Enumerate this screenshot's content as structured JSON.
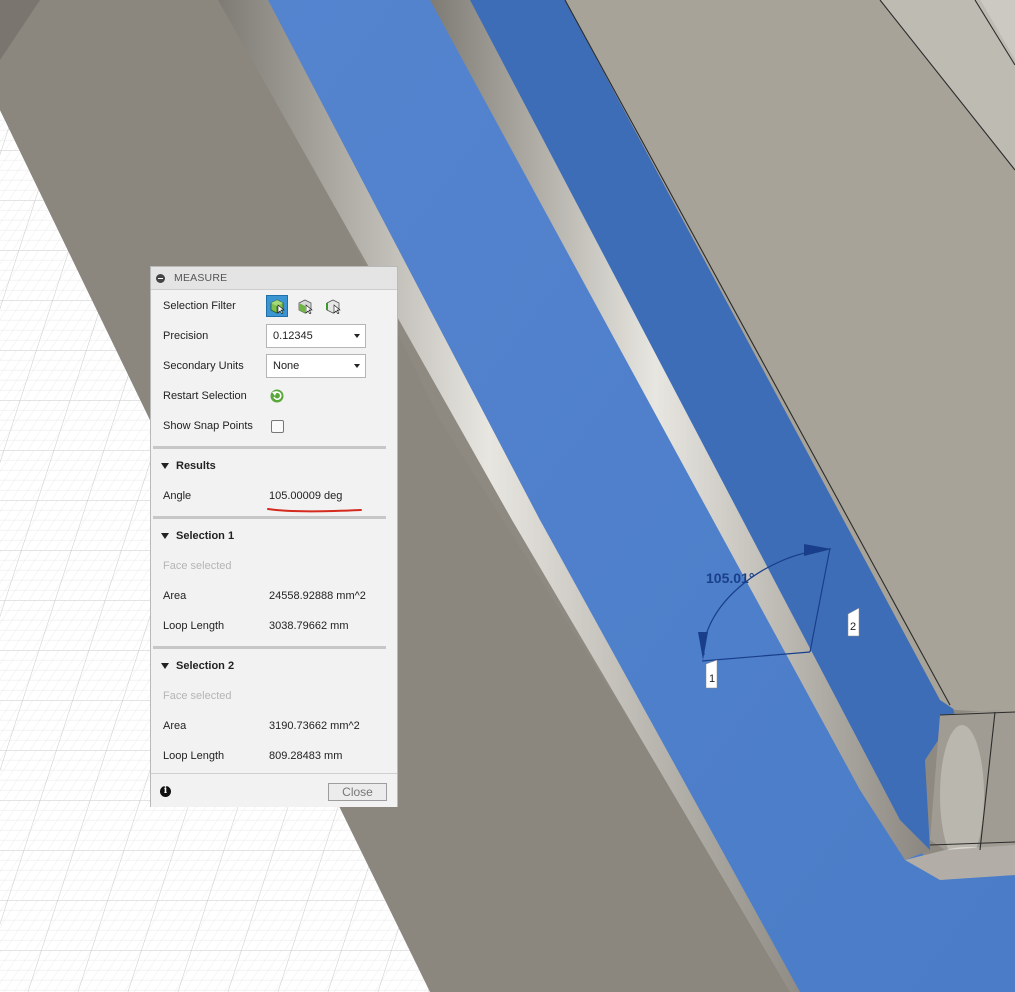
{
  "panel": {
    "title": "MEASURE",
    "selection_filter_label": "Selection Filter",
    "filter_icons": [
      "select-body-icon",
      "select-face-icon",
      "select-edge-icon"
    ],
    "precision_label": "Precision",
    "precision_value": "0.12345",
    "secondary_units_label": "Secondary Units",
    "secondary_units_value": "None",
    "restart_selection_label": "Restart Selection",
    "show_snap_points_label": "Show Snap Points",
    "show_snap_points_checked": false,
    "results": {
      "heading": "Results",
      "angle_label": "Angle",
      "angle_value": "105.00009 deg"
    },
    "selection1": {
      "heading": "Selection 1",
      "status": "Face selected",
      "area_label": "Area",
      "area_value": "24558.92888 mm^2",
      "loop_label": "Loop Length",
      "loop_value": "3038.79662 mm"
    },
    "selection2": {
      "heading": "Selection 2",
      "status": "Face selected",
      "area_label": "Area",
      "area_value": "3190.73662 mm^2",
      "loop_label": "Loop Length",
      "loop_value": "809.28483 mm"
    },
    "close_label": "Close"
  },
  "viewport": {
    "angle_annotation": "105.01°",
    "marker1": "1",
    "marker2": "2"
  },
  "colors": {
    "selected_face": "#4f7fc9",
    "selected_face_dark": "#3d6bb8",
    "body_grey": "#918d85",
    "top_surface": "#a8a49b",
    "annotation": "#1a3f8a",
    "highlight_underline": "#d42b1e"
  }
}
